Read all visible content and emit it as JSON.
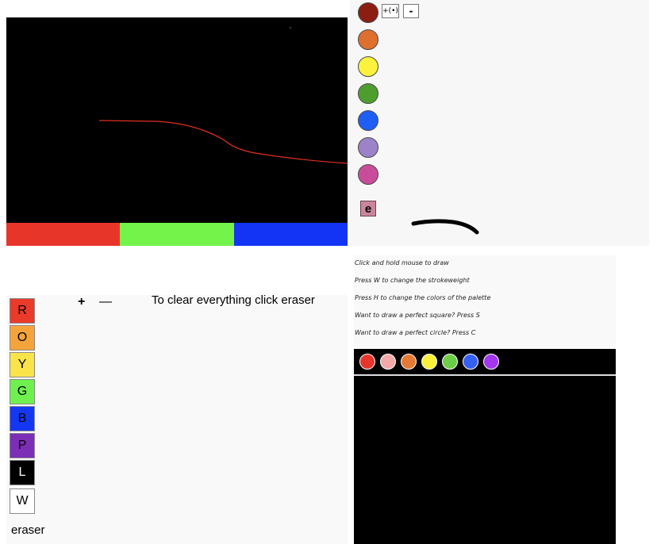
{
  "panel1": {
    "strip_colors": [
      "#e8352a",
      "#74f34a",
      "#1334f5"
    ],
    "stroke_color": "#e03020"
  },
  "panel2": {
    "swatches": [
      "#8b1d12",
      "#df6f2f",
      "#fbf23d",
      "#4e9e2f",
      "#1e5ef5",
      "#9c82c9",
      "#c94c9a"
    ],
    "strokeweight_up_label": "+(•)",
    "strokeweight_down_label": "-",
    "eraser_label": "e"
  },
  "panel3": {
    "plus_label": "+",
    "minus_label": "—",
    "clear_hint": "To clear everything click eraser",
    "eraser_label": "eraser",
    "keys": [
      {
        "label": "R",
        "color": "#ea3a2a",
        "text": "#000000"
      },
      {
        "label": "O",
        "color": "#f5a43c",
        "text": "#000000"
      },
      {
        "label": "Y",
        "color": "#fbe34a",
        "text": "#000000"
      },
      {
        "label": "G",
        "color": "#6ff04f",
        "text": "#000000"
      },
      {
        "label": "B",
        "color": "#1437f4",
        "text": "#000000"
      },
      {
        "label": "P",
        "color": "#7c2fb6",
        "text": "#000000"
      },
      {
        "label": "L",
        "color": "#000000",
        "text": "#ffffff"
      },
      {
        "label": "W",
        "color": "#ffffff",
        "text": "#000000"
      }
    ]
  },
  "panel4": {
    "instructions": [
      "Click and hold mouse to draw",
      "Press W to change the strokeweight",
      "Press H to change the colors of the palette",
      "Want to draw a perfect square? Press S",
      "Want to draw a perfect circle? Press C"
    ],
    "palette": [
      "#e7352d",
      "#f2a8a8",
      "#e57a34",
      "#fbf03a",
      "#6ccd47",
      "#3560f4",
      "#a336ee"
    ]
  }
}
